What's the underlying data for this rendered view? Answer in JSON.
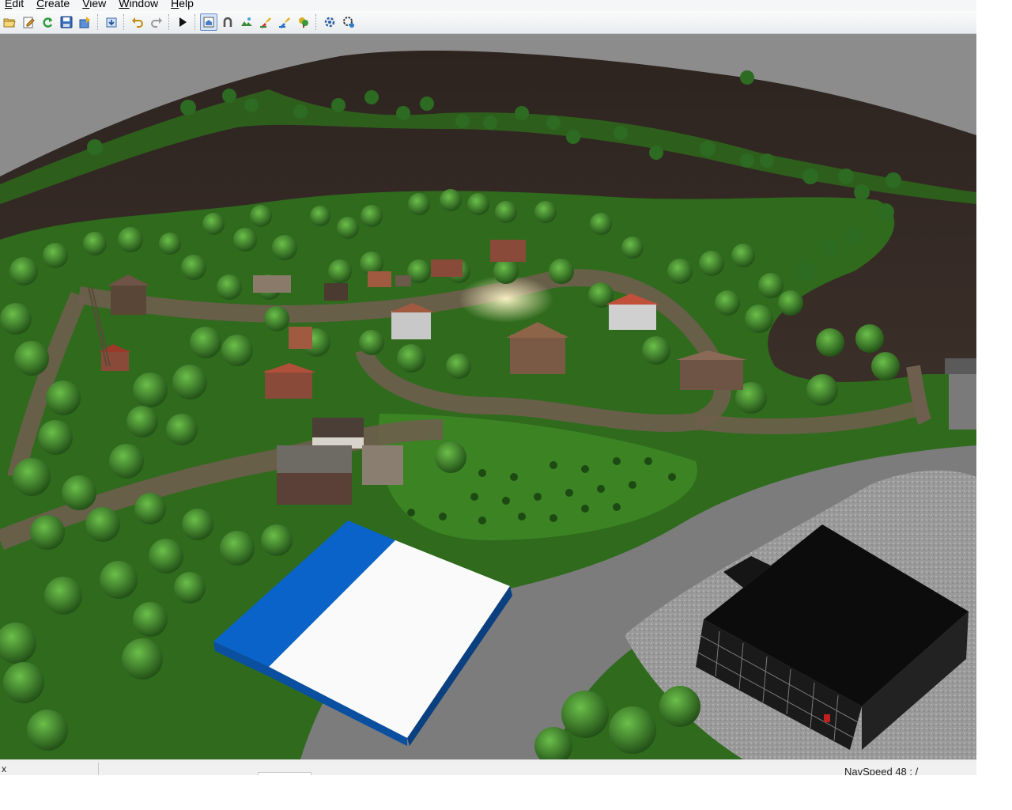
{
  "menu": {
    "items": [
      {
        "mnemonic": "E",
        "rest": "dit"
      },
      {
        "mnemonic": "C",
        "rest": "reate"
      },
      {
        "mnemonic": "V",
        "rest": "iew"
      },
      {
        "mnemonic": "W",
        "rest": "indow"
      },
      {
        "mnemonic": "H",
        "rest": "elp"
      }
    ]
  },
  "toolbar": {
    "icons": [
      "open-icon",
      "edit-icon",
      "refresh-icon",
      "save-icon",
      "export-icon",
      "import-icon",
      "undo-icon",
      "redo-icon",
      "play-icon",
      "home-view-icon",
      "magnet-icon",
      "terrain-icon",
      "paint-icon",
      "foliage-icon",
      "plant-icon",
      "settings-icon",
      "tools-icon"
    ],
    "active": "home-view-icon"
  },
  "viewport": {
    "sky_color": "#8c8c8c",
    "field_color": "#3d2f28",
    "grass_color": "#2f6a1d",
    "road_color": "#7c7c7c",
    "building_blue": "#0a63c8",
    "building_black": "#0c0c0c"
  },
  "status": {
    "left_text": "x",
    "navspeed": "NavSpeed 48 : /"
  }
}
